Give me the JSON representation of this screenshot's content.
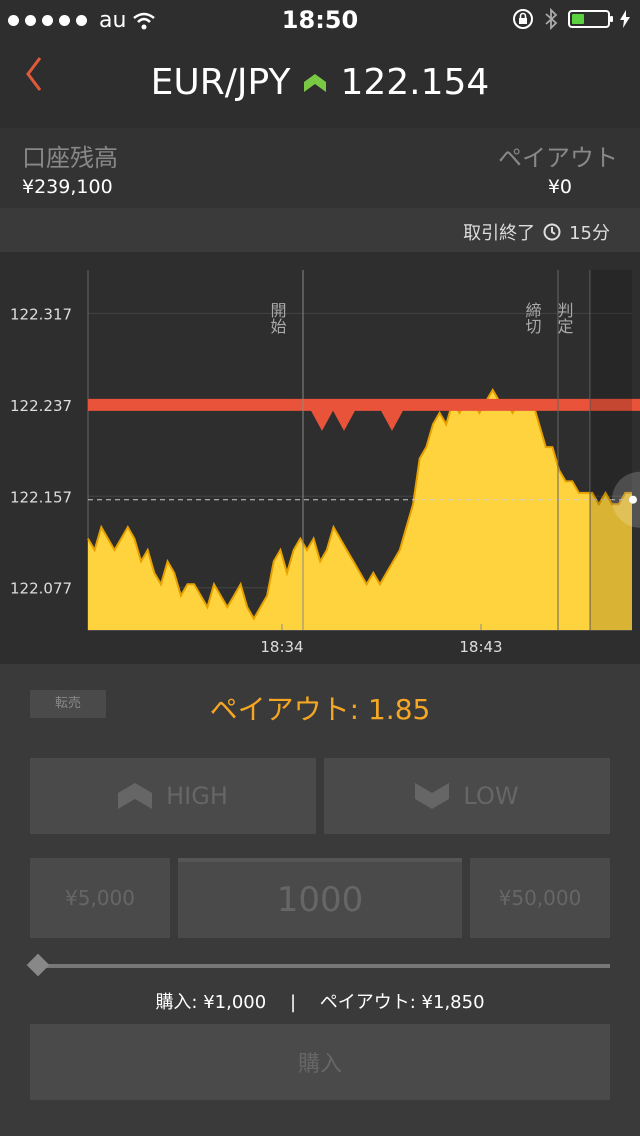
{
  "status": {
    "carrier": "au",
    "time": "18:50"
  },
  "header": {
    "back_icon": "chevron-left-icon",
    "pair": "EUR/JPY",
    "rate": "122.154",
    "trend_color": "#7ac943"
  },
  "account": {
    "balance_label": "口座残高",
    "balance_value": "¥239,100",
    "payout_label": "ペイアウト",
    "payout_value": "¥0"
  },
  "trade_time": {
    "label": "取引終了",
    "duration": "15分"
  },
  "chart_data": {
    "type": "area",
    "ylim": [
      122.04,
      122.355
    ],
    "yticks": [
      "122.317",
      "122.237",
      "122.157",
      "122.077"
    ],
    "ytick_values": [
      122.317,
      122.237,
      122.157,
      122.077
    ],
    "xticks": [
      "18:34",
      "18:43"
    ],
    "markers": [
      {
        "label": "開始"
      },
      {
        "label": "締切"
      },
      {
        "label": "判定"
      }
    ],
    "strike": 122.237,
    "current": 122.154,
    "series": [
      {
        "values": [
          122.12,
          122.11,
          122.13,
          122.12,
          122.11,
          122.12,
          122.13,
          122.12,
          122.1,
          122.11,
          122.09,
          122.08,
          122.1,
          122.09,
          122.07,
          122.08,
          122.08,
          122.07,
          122.06,
          122.08,
          122.07,
          122.06,
          122.07,
          122.08,
          122.06,
          122.05,
          122.06,
          122.07,
          122.1,
          122.11,
          122.09,
          122.11,
          122.12,
          122.11,
          122.12,
          122.1,
          122.11,
          122.13,
          122.12,
          122.11,
          122.1,
          122.09,
          122.08,
          122.09,
          122.08,
          122.09,
          122.1,
          122.11,
          122.13,
          122.15,
          122.19,
          122.2,
          122.22,
          122.23,
          122.22,
          122.24,
          122.23,
          122.24,
          122.24,
          122.23,
          122.24,
          122.25,
          122.24,
          122.24,
          122.23,
          122.24,
          122.24,
          122.24,
          122.22,
          122.2,
          122.2,
          122.18,
          122.17,
          122.17,
          122.16,
          122.16,
          122.16,
          122.15,
          122.16,
          122.15,
          122.15,
          122.16,
          122.16
        ]
      }
    ]
  },
  "controls": {
    "resell_label": "転売",
    "payout_rate": "ペイアウト: 1.85",
    "high_label": "HIGH",
    "low_label": "LOW",
    "amount_left": "¥5,000",
    "amount_value": "1000",
    "amount_right": "¥50,000",
    "purchase_summary": "購入: ¥1,000",
    "payout_summary": "ペイアウト: ¥1,850",
    "buy_label": "購入"
  }
}
